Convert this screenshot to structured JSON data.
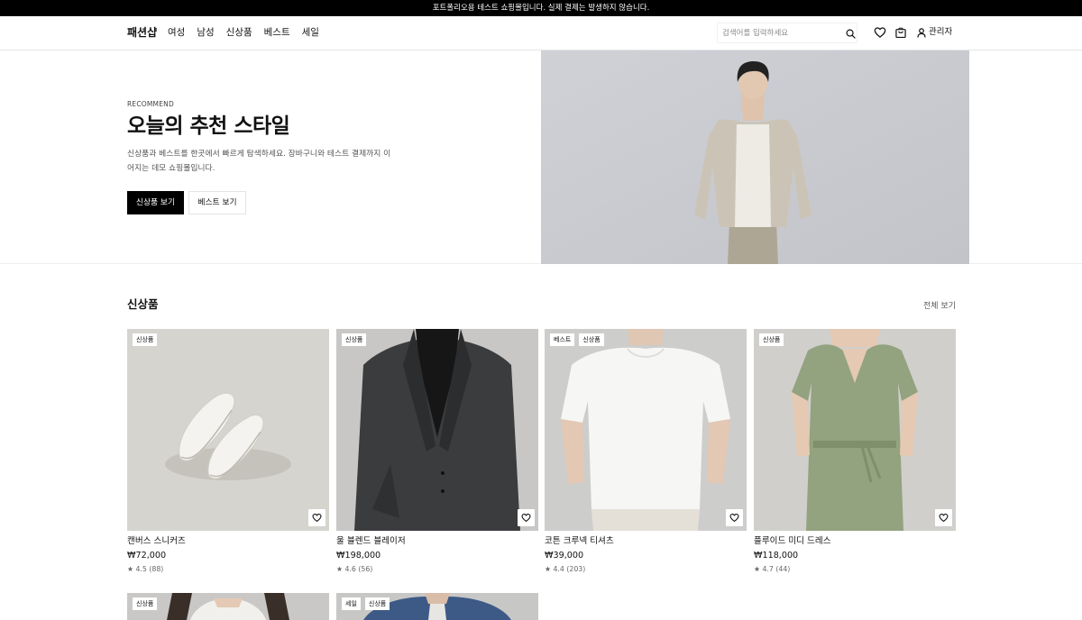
{
  "notice": {
    "text": "포트폴리오용 테스트 쇼핑몰입니다. 실제 결제는 발생하지 않습니다."
  },
  "header": {
    "logo": "패션샵",
    "nav": [
      "여성",
      "남성",
      "신상품",
      "베스트",
      "세일"
    ],
    "search_placeholder": "검색어를 입력하세요",
    "icons": [
      "search-icon",
      "heart-icon",
      "cart-icon",
      "user-icon"
    ],
    "admin_label": "관리자"
  },
  "hero": {
    "kicker": "RECOMMEND",
    "title": "오늘의 추천 스타일",
    "description": "신상품과 베스트를 한곳에서 빠르게 탐색하세요. 장바구니와 테스트 결제까지 이어지는 데모 쇼핑몰입니다.",
    "primary_button": "신상품 보기",
    "secondary_button": "베스트 보기"
  },
  "section": {
    "title": "신상품",
    "see_all": "전체 보기"
  },
  "products": [
    {
      "badges": [
        "신상품"
      ],
      "name": "캔버스 스니커즈",
      "price": "₩72,000",
      "rating": "★ 4.5 (88)"
    },
    {
      "badges": [
        "신상품"
      ],
      "name": "울 블렌드 블레이저",
      "price": "₩198,000",
      "rating": "★ 4.6 (56)"
    },
    {
      "badges": [
        "베스트",
        "신상품"
      ],
      "name": "코튼 크루넥 티셔츠",
      "price": "₩39,000",
      "rating": "★ 4.4 (203)"
    },
    {
      "badges": [
        "신상품"
      ],
      "name": "플루이드 미디 드레스",
      "price": "₩118,000",
      "rating": "★ 4.7 (44)"
    },
    {
      "badges": [
        "신상품"
      ]
    },
    {
      "badges": [
        "세일",
        "신상품"
      ]
    }
  ],
  "colors": {
    "notice_bg": "#000000",
    "primary": "#000000",
    "text": "#111111",
    "muted": "#666666"
  }
}
